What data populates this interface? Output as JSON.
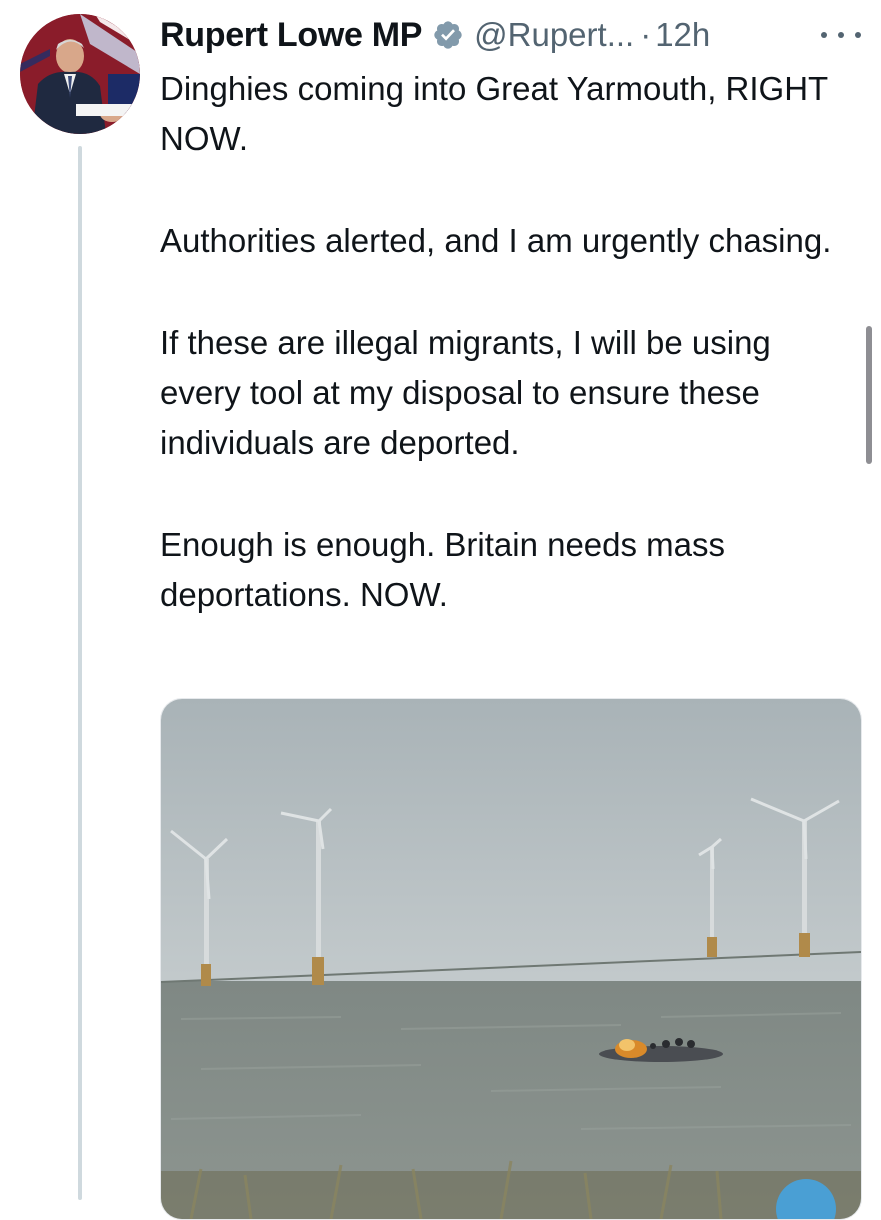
{
  "tweet": {
    "author_name": "Rupert Lowe MP",
    "handle": "@Rupert...",
    "separator": "·",
    "timestamp": "12h",
    "verified": true,
    "paragraphs": [
      "Dinghies coming into Great Yarmouth, RIGHT NOW.",
      "Authorities alerted, and I am urgently chasing.",
      "If these are illegal migrants, I will be using every tool at my disposal to ensure these individuals are deported.",
      "Enough is enough. Britain needs mass deportations. NOW."
    ]
  },
  "media": {
    "description_icon": "photo-of-sea-with-wind-turbines-and-dinghy"
  },
  "colors": {
    "verified_badge": "#829aab",
    "secondary_text": "#536471",
    "thread_line": "#cfd9de"
  },
  "icons": {
    "verified": "verified-badge-icon",
    "more": "more-options-icon"
  }
}
